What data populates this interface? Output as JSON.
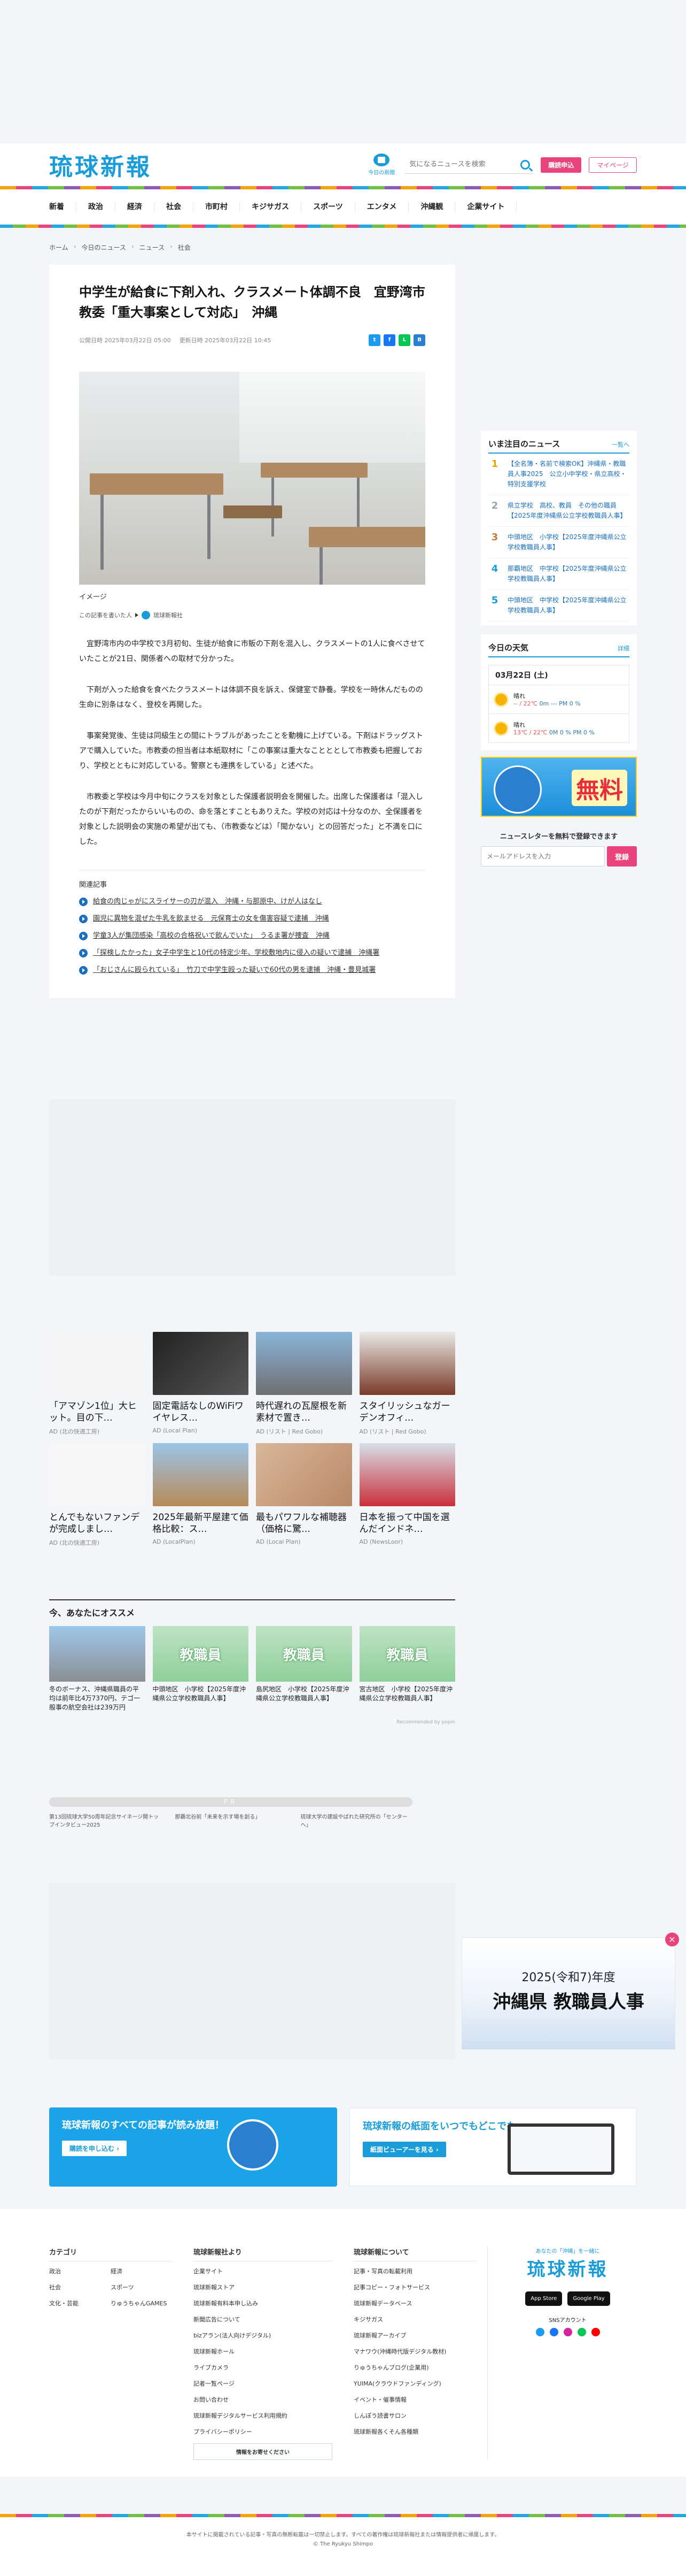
{
  "header": {
    "logo": "琉球新報",
    "paper_label": "今日の新聞",
    "search_placeholder": "気になるニュースを検索",
    "subscribe": "購読申込",
    "mypage": "マイページ"
  },
  "nav": [
    "新着",
    "政治",
    "経済",
    "社会",
    "市町村",
    "キジサガス",
    "スポーツ",
    "エンタメ",
    "沖縄観",
    "企業サイト"
  ],
  "breadcrumb": [
    "ホーム",
    "今日のニュース",
    "ニュース",
    "社会"
  ],
  "article": {
    "title": "中学生が給食に下剤入れ、クラスメート体調不良　宜野湾市教委「重大事案として対応」　沖縄",
    "published": "公開日時 2025年03月22日 05:00",
    "updated": "更新日時 2025年03月22日 10:45",
    "caption": "イメージ",
    "credit_label": "この記事を書いた人",
    "credit_name": "琉球新報社",
    "paragraphs": [
      "宜野湾市内の中学校で3月初旬、生徒が給食に市販の下剤を混入し、クラスメートの1人に食べさせていたことが21日、関係者への取材で分かった。",
      "下剤が入った給食を食べたクラスメートは体調不良を訴え、保健室で静養。学校を一時休んだものの生命に別条はなく、登校を再開した。",
      "事案発覚後、生徒は同級生との間にトラブルがあったことを動機に上げている。下剤はドラッグストアで購入していた。市教委の担当者は本紙取材に「この事案は重大なことととして市教委も把握しており、学校とともに対応している。警察とも連携をしている」と述べた。",
      "市教委と学校は今月中旬にクラスを対象とした保護者説明会を開催した。出席した保護者は「混入したのが下剤だったからいいものの、命を落とすこともありえた。学校の対応は十分なのか、全保護者を対象とした説明会の実施の希望が出ても、（市教委などは）「聞かない」との回答だった」と不満を口にした。"
    ],
    "related_title": "関連記事",
    "related": [
      "給食の肉じゃがにスライサーの刃が混入　沖縄・与那原中、けが人はなし",
      "園児に異物を混ぜた牛乳を飲ませる　元保育士の女を傷害容疑で逮捕　沖縄",
      "学童3人が集団感染「高校の合格祝いで飲んでいた」　うるま署が捜査　沖縄",
      "「探検したかった」女子中学生と10代の特定少年、学校敷地内に侵入の疑いで逮捕　沖縄署",
      "「おじさんに殴られている」　竹刀で中学生殴った疑いで60代の男を逮捕　沖縄・豊見城署"
    ]
  },
  "ranking": {
    "title": "いま注目のニュース",
    "more": "一覧へ",
    "items": [
      "【全名簿・名前で検索OK】沖縄県・教職員人事2025　公立小中学校・県立高校・特別支援学校",
      "県立学校　高校、教員　その他の職員【2025年度沖縄県公立学校教職員人事】",
      "中頭地区　小学校【2025年度沖縄県公立学校教職員人事】",
      "那覇地区　中学校【2025年度沖縄県公立学校教職員人事】",
      "中頭地区　中学校【2025年度沖縄県公立学校教職員人事】"
    ]
  },
  "weather": {
    "title": "今日の天気",
    "more": "詳細",
    "date": "03月22日 (土)",
    "rows": [
      {
        "label": "晴れ",
        "temp": "-- / 22℃",
        "wind": "0m  ---  PM 0 %"
      },
      {
        "label": "晴れ",
        "temp": "13℃ / 22℃",
        "wind": "0M 0 %  PM 0 %"
      }
    ]
  },
  "side_ad": {
    "text": "無料"
  },
  "newsletter": {
    "title": "ニュースレターを無料で登録できます",
    "placeholder": "メールアドレスを入力",
    "button": "登録"
  },
  "reco": [
    {
      "title": "「アマゾン1位」大ヒット。目の下…",
      "source": "AD (北の快適工房)"
    },
    {
      "title": "固定電話なしのWiFiワイヤレス…",
      "source": "AD (Local Plan)"
    },
    {
      "title": "時代遅れの瓦屋根を新素材で置き…",
      "source": "AD (リスト | Red Gobo)"
    },
    {
      "title": "スタイリッシュなガーデンオフィ…",
      "source": "AD (リスト | Red Gobo)"
    },
    {
      "title": "とんでもないファンデが完成しまし…",
      "source": "AD (北の快適工房)"
    },
    {
      "title": "2025年最新平屋建て価格比較：ス…",
      "source": "AD (LocalPlan)"
    },
    {
      "title": "最もパワフルな補聴器（価格に驚…",
      "source": "AD (Local Plan)"
    },
    {
      "title": "日本を振って中国を選んだインドネ…",
      "source": "AD (NewsLoor)"
    }
  ],
  "osusume": {
    "title": "今、あなたにオススメ",
    "items": [
      "冬のボーナス、沖縄県職員の平均は前年比4万7370円、テゴ一般事の航空会社は239万円",
      "中頭地区　小学校【2025年度沖縄県公立学校教職員人事】",
      "島尻地区　小学校【2025年度沖縄県公立学校教職員人事】",
      "宮古地区　小学校【2025年度沖縄県公立学校教職員人事】"
    ],
    "popin": "Recommended by popIn"
  },
  "pr": {
    "label": "PR",
    "links": [
      "第13回琉球大学50周年記念サイネージ開トップインタビュー2025",
      "那覇北谷前「未来を示す場を創る」",
      "琉球大学の建設やばれた研究所の「センターへ」"
    ]
  },
  "jinji": {
    "year": "2025(令和7)年度",
    "main": "沖縄県 教職員人事",
    "close": "×"
  },
  "banners": [
    {
      "title": "琉球新報のすべての記事が読み放題！",
      "cta": "購読を申し込む ›"
    },
    {
      "title": "琉球新報の紙面をいつでもどこでも。",
      "cta": "紙面ビューアーを見る ›"
    }
  ],
  "footer": {
    "cat_title": "カテゴリ",
    "categories": [
      "政治",
      "経済",
      "社会",
      "スポーツ",
      "文化・芸能",
      "りゅうちゃんGAMES"
    ],
    "about_title": "琉球新報社より",
    "about": [
      "企業サイト",
      "琉球新報ストア",
      "琉球新報有料本申し込み",
      "新聞広告について",
      "bizアラン(法人向けデジタル)",
      "琉球新報ホール",
      "ライブカメラ",
      "記者一覧ページ",
      "お問い合わせ",
      "琉球新報デジタルサービス利用規約",
      "プライバシーポリシー"
    ],
    "about_button": "情報をお寄せください",
    "company_title": "琉球新報について",
    "company": [
      "記事・写真の転載利用",
      "記事コピー・フォトサービス",
      "琉球新報データベース",
      "キジサガス",
      "琉球新報アーカイブ",
      "マナワウ(沖縄時代版デジタル教材)",
      "りゅうちゃんブログ(企業用)",
      "YUIMA(クラウドファンディング)",
      "イベント・催事情報",
      "しんぽう読書サロン",
      "琉球新報各くそん各種類"
    ],
    "tagline": "あなたの「沖縄」を一緒に",
    "app_store": "App Store",
    "google_play": "Google Play",
    "sns_title": "SNSアカウント",
    "copyright1": "本サイトに掲載されている記事・写真の無断転載は一切禁止します。すべての著作権は琉球新報社または情報提供者に帰属します。",
    "copyright2": "© The Ryukyu Shimpo"
  },
  "colors": {
    "brand": "#1a9cd8",
    "accent": "#e9437b"
  }
}
